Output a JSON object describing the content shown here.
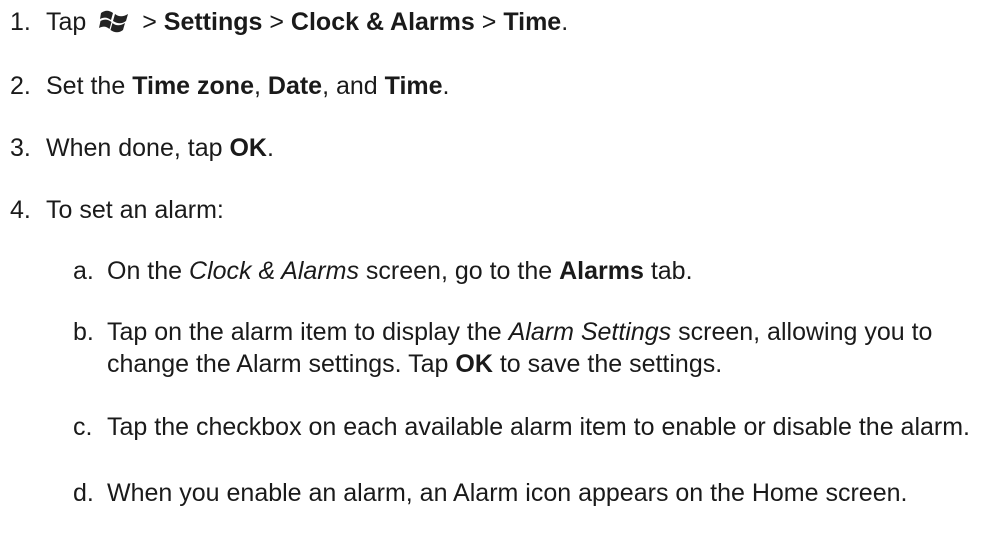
{
  "steps": [
    {
      "num": "1.",
      "tap": "Tap",
      "sep1": ">",
      "settings": "Settings",
      "sep2": ">",
      "clock_alarms": "Clock & Alarms",
      "sep3": ">",
      "time": "Time",
      "end": "."
    },
    {
      "num": "2.",
      "pre": "Set the",
      "time_zone": "Time zone",
      "comma1": ",",
      "date": "Date",
      "mid": ", and",
      "time": "Time",
      "end": "."
    },
    {
      "num": "3.",
      "pre": "When done, tap",
      "ok": "OK",
      "end": "."
    },
    {
      "num": "4.",
      "text": "To set an alarm:"
    }
  ],
  "substeps": {
    "a": {
      "num": "a.",
      "pre": "On the",
      "screen": "Clock & Alarms",
      "mid": "screen, go to the",
      "tab": "Alarms",
      "end": "tab."
    },
    "b": {
      "num": "b.",
      "pre": "Tap on the alarm item to display the",
      "screen": "Alarm Settings",
      "mid": "screen, allowing you to change the Alarm settings. Tap",
      "ok": "OK",
      "end": "to save the settings."
    },
    "c": {
      "num": "c.",
      "text": "Tap the checkbox on each available alarm item to enable or disable the alarm."
    },
    "d": {
      "num": "d.",
      "text": "When you enable an alarm, an Alarm icon appears on the Home screen."
    }
  },
  "icons": {
    "start": "windows-logo"
  }
}
